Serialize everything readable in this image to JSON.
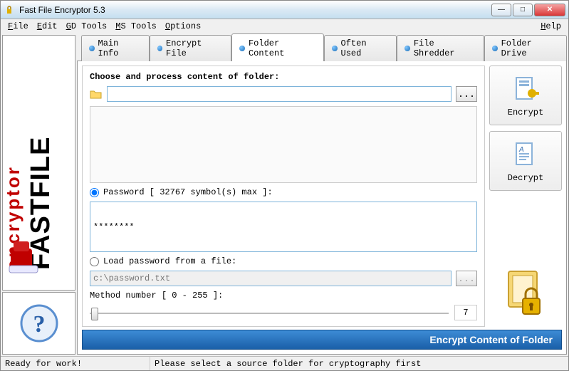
{
  "title": "Fast File Encryptor 5.3",
  "menu": {
    "file": "File",
    "edit": "Edit",
    "gd": "GD Tools",
    "ms": "MS Tools",
    "options": "Options",
    "help": "Help"
  },
  "tabs": {
    "main_info": "Main Info",
    "encrypt_file": "Encrypt File",
    "folder_content": "Folder Content",
    "often_used": "Often Used",
    "file_shredder": "File Shredder",
    "folder_drive": "Folder Drive"
  },
  "form": {
    "heading": "Choose and process content of folder:",
    "folder_value": "",
    "browse_label": "...",
    "password_radio": "Password [ 32767 symbol(s) max ]:",
    "password_value": "********",
    "loadfile_radio": "Load password from a file:",
    "loadfile_placeholder": "c:\\password.txt",
    "method_label": "Method number [ 0 - 255 ]:",
    "method_value": "7"
  },
  "actions": {
    "encrypt": "Encrypt",
    "decrypt": "Decrypt"
  },
  "main_button": "Encrypt Content of Folder",
  "status": {
    "left": "Ready for work!",
    "right": "Please select a source folder for cryptography first"
  },
  "logo": {
    "line1": "FASTFILE",
    "line2": "encryptor"
  }
}
